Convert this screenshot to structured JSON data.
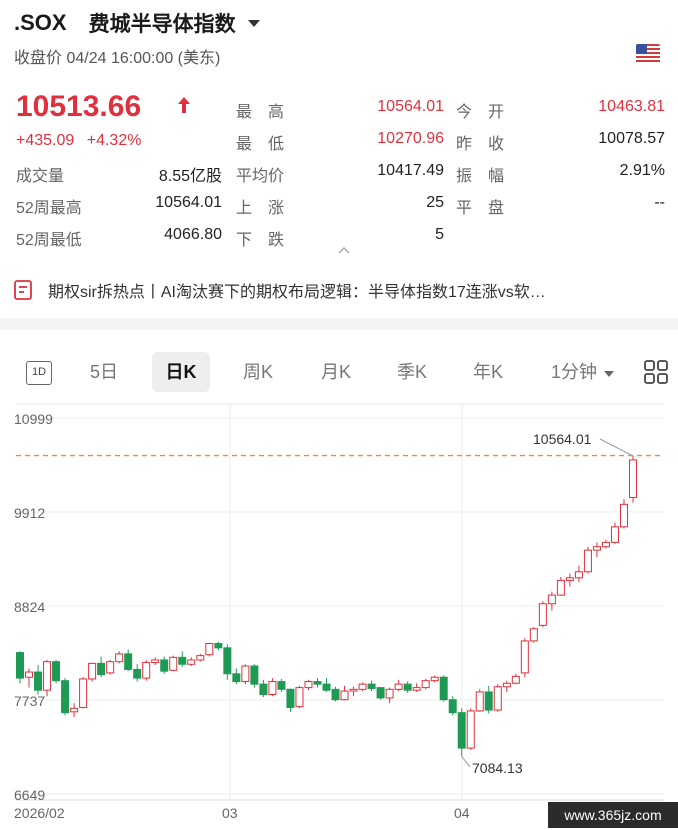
{
  "header": {
    "ticker": ".SOX",
    "name": "费城半导体指数",
    "close_label": "收盘价",
    "close_time": "04/24 16:00:00 (美东)"
  },
  "quote": {
    "price": "10513.66",
    "change": "+435.09",
    "change_pct": "+4.32%",
    "rows": [
      {
        "label": "最　高",
        "value": "10564.01",
        "red": true,
        "label2": "今　开",
        "value2": "10463.81",
        "red2": true
      },
      {
        "label": "最　低",
        "value": "10270.96",
        "red": true,
        "label2": "昨　收",
        "value2": "10078.57",
        "red2": false
      },
      {
        "label": "平均价",
        "value": "10417.49",
        "red": false,
        "label2": "振　幅",
        "value2": "2.91%",
        "red2": false
      },
      {
        "label": "上　涨",
        "value": "25",
        "red": false,
        "label2": "平　盘",
        "value2": "--",
        "red2": false
      },
      {
        "label": "下　跌",
        "value": "5",
        "red": false,
        "label2": "",
        "value2": "",
        "red2": false
      }
    ],
    "left_rows": [
      {
        "label": "成交量",
        "value": "8.55亿股"
      },
      {
        "label": "52周最高",
        "value": "10564.01"
      },
      {
        "label": "52周最低",
        "value": "4066.80"
      }
    ]
  },
  "news": {
    "text": "期权sir拆热点丨AI淘汰赛下的期权布局逻辑：半导体指数17连涨vs软…"
  },
  "tabs": {
    "items": [
      "1D",
      "5日",
      "日K",
      "周K",
      "月K",
      "季K",
      "年K",
      "1分钟"
    ],
    "active": "日K"
  },
  "colors": {
    "up": "#e0303e",
    "down": "#1f9a55",
    "dashed": "#f08a3a"
  },
  "chart_data": {
    "type": "candlestick",
    "y_ticks": [
      "10999",
      "9912",
      "8824",
      "7737",
      "6649"
    ],
    "ylim": [
      6649,
      10999
    ],
    "x_ticks": [
      "2026/02",
      "03",
      "04"
    ],
    "max_label": "10564.01",
    "min_label": "7084.13",
    "reference_line": 10564.01,
    "candles": [
      [
        8285,
        8300,
        7930,
        7990
      ],
      [
        8000,
        8100,
        7880,
        8060
      ],
      [
        8060,
        8140,
        7800,
        7850
      ],
      [
        7850,
        8200,
        7780,
        8180
      ],
      [
        8180,
        8200,
        7930,
        7960
      ],
      [
        7960,
        7990,
        7560,
        7590
      ],
      [
        7600,
        7700,
        7540,
        7640
      ],
      [
        7650,
        8000,
        7640,
        7980
      ],
      [
        7980,
        8170,
        7950,
        8160
      ],
      [
        8160,
        8240,
        8000,
        8030
      ],
      [
        8050,
        8200,
        8030,
        8180
      ],
      [
        8180,
        8300,
        8160,
        8270
      ],
      [
        8270,
        8320,
        8070,
        8090
      ],
      [
        8090,
        8150,
        7950,
        7990
      ],
      [
        7990,
        8200,
        7960,
        8170
      ],
      [
        8170,
        8230,
        8140,
        8200
      ],
      [
        8200,
        8240,
        8040,
        8070
      ],
      [
        8080,
        8250,
        8070,
        8230
      ],
      [
        8230,
        8300,
        8120,
        8150
      ],
      [
        8150,
        8230,
        8130,
        8200
      ],
      [
        8200,
        8270,
        8180,
        8250
      ],
      [
        8260,
        8400,
        8240,
        8390
      ],
      [
        8390,
        8410,
        8310,
        8340
      ],
      [
        8340,
        8380,
        7970,
        8040
      ],
      [
        8040,
        8100,
        7920,
        7950
      ],
      [
        7950,
        8150,
        7920,
        8130
      ],
      [
        8130,
        8150,
        7880,
        7920
      ],
      [
        7920,
        7970,
        7770,
        7800
      ],
      [
        7800,
        7990,
        7780,
        7950
      ],
      [
        7950,
        7980,
        7830,
        7860
      ],
      [
        7860,
        7870,
        7600,
        7650
      ],
      [
        7660,
        7900,
        7640,
        7880
      ],
      [
        7880,
        7970,
        7850,
        7950
      ],
      [
        7950,
        7990,
        7880,
        7920
      ],
      [
        7920,
        7990,
        7830,
        7850
      ],
      [
        7860,
        7890,
        7720,
        7740
      ],
      [
        7740,
        7900,
        7730,
        7840
      ],
      [
        7840,
        7890,
        7780,
        7860
      ],
      [
        7860,
        7940,
        7840,
        7920
      ],
      [
        7920,
        7960,
        7840,
        7870
      ],
      [
        7880,
        7880,
        7740,
        7760
      ],
      [
        7760,
        7880,
        7700,
        7860
      ],
      [
        7860,
        7970,
        7840,
        7920
      ],
      [
        7920,
        7950,
        7820,
        7850
      ],
      [
        7850,
        7930,
        7830,
        7880
      ],
      [
        7880,
        7980,
        7860,
        7960
      ],
      [
        7960,
        8020,
        7940,
        8000
      ],
      [
        8000,
        8020,
        7720,
        7740
      ],
      [
        7740,
        7780,
        7560,
        7590
      ],
      [
        7590,
        7640,
        7084,
        7180
      ],
      [
        7180,
        7640,
        7160,
        7610
      ],
      [
        7610,
        7860,
        7600,
        7830
      ],
      [
        7830,
        7900,
        7580,
        7620
      ],
      [
        7620,
        7920,
        7600,
        7890
      ],
      [
        7890,
        7960,
        7830,
        7930
      ],
      [
        7930,
        8040,
        7920,
        8010
      ],
      [
        8050,
        8450,
        8000,
        8420
      ],
      [
        8420,
        8580,
        8400,
        8560
      ],
      [
        8600,
        8880,
        8580,
        8850
      ],
      [
        8850,
        8990,
        8770,
        8950
      ],
      [
        8950,
        9160,
        8940,
        9120
      ],
      [
        9120,
        9200,
        9050,
        9150
      ],
      [
        9150,
        9290,
        9100,
        9220
      ],
      [
        9220,
        9510,
        9200,
        9470
      ],
      [
        9470,
        9560,
        9390,
        9510
      ],
      [
        9510,
        9590,
        9490,
        9560
      ],
      [
        9560,
        9790,
        9540,
        9740
      ],
      [
        9740,
        10060,
        9720,
        10000
      ],
      [
        10080,
        10560,
        10020,
        10514
      ]
    ]
  }
}
